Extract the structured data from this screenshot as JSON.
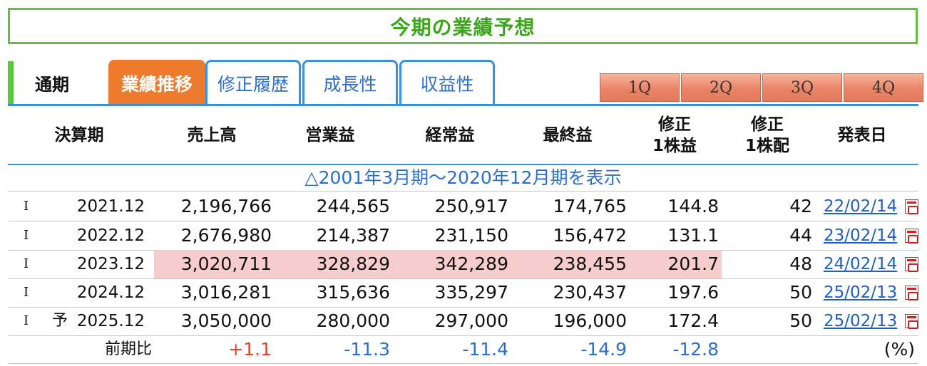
{
  "title": "今期の業績予想",
  "tabs": {
    "fixed": "通期",
    "items": [
      {
        "label": "業績推移",
        "active": true
      },
      {
        "label": "修正履歴",
        "active": false
      },
      {
        "label": "成長性",
        "active": false
      },
      {
        "label": "収益性",
        "active": false
      }
    ],
    "quarters": [
      "1Q",
      "2Q",
      "3Q",
      "4Q"
    ]
  },
  "colors": {
    "accent_green": "#5cc43f",
    "active_tab": "#ee7a2e",
    "link_blue": "#2a6fcf",
    "highlight": "#f7cccc",
    "positive": "#e0442a",
    "negative": "#2a6fcf"
  },
  "columns": {
    "period": "決算期",
    "sales": "売上高",
    "op": "営業益",
    "ord": "経常益",
    "net": "最終益",
    "eps_1": "修正",
    "eps_2": "1株益",
    "div_1": "修正",
    "div_2": "1株配",
    "date": "発表日"
  },
  "toggle_text": "△2001年3月期～2020年12月期を表示",
  "rows": [
    {
      "mark": "I",
      "forecast": "",
      "period": "2021.12",
      "sales": "2,196,766",
      "op": "244,565",
      "ord": "250,917",
      "net": "174,765",
      "eps": "144.8",
      "div": "42",
      "date": "22/02/14",
      "highlight": false
    },
    {
      "mark": "I",
      "forecast": "",
      "period": "2022.12",
      "sales": "2,676,980",
      "op": "214,387",
      "ord": "231,150",
      "net": "156,472",
      "eps": "131.1",
      "div": "44",
      "date": "23/02/14",
      "highlight": false
    },
    {
      "mark": "I",
      "forecast": "",
      "period": "2023.12",
      "sales": "3,020,711",
      "op": "328,829",
      "ord": "342,289",
      "net": "238,455",
      "eps": "201.7",
      "div": "48",
      "date": "24/02/14",
      "highlight": true
    },
    {
      "mark": "I",
      "forecast": "",
      "period": "2024.12",
      "sales": "3,016,281",
      "op": "315,636",
      "ord": "335,297",
      "net": "230,437",
      "eps": "197.6",
      "div": "50",
      "date": "25/02/13",
      "highlight": false
    },
    {
      "mark": "I",
      "forecast": "予",
      "period": "2025.12",
      "sales": "3,050,000",
      "op": "280,000",
      "ord": "297,000",
      "net": "196,000",
      "eps": "172.4",
      "div": "50",
      "date": "25/02/13",
      "highlight": false
    }
  ],
  "ratio": {
    "label": "前期比",
    "sales": "+1.1",
    "op": "-11.3",
    "ord": "-11.4",
    "net": "-14.9",
    "eps": "-12.8",
    "unit": "(%)"
  }
}
